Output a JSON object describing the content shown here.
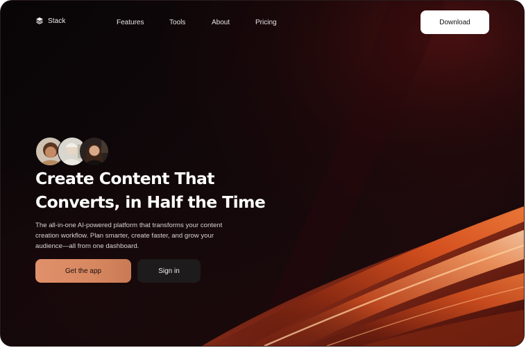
{
  "brand": {
    "name": "Stack",
    "logo_icon": "stack-layers-icon"
  },
  "nav": {
    "links": [
      {
        "label": "Features"
      },
      {
        "label": "Tools"
      },
      {
        "label": "About"
      },
      {
        "label": "Pricing"
      }
    ],
    "download_label": "Download"
  },
  "hero": {
    "avatars": [
      "avatar-person-1",
      "avatar-person-2",
      "avatar-person-3"
    ],
    "headline_line1": "Create Content That",
    "headline_line2": "Converts, in Half the Time",
    "description_line1": "The all-in-one AI-powered platform that transforms your content",
    "description_line2": "creation workflow. Plan smarter, create faster, and grow your",
    "description_line3": "audience—all from one dashboard.",
    "primary_cta": "Get the app",
    "secondary_cta": "Sign in"
  },
  "colors": {
    "background": "#0a0608",
    "accent": "#d88860",
    "glow": "#e0502a"
  }
}
